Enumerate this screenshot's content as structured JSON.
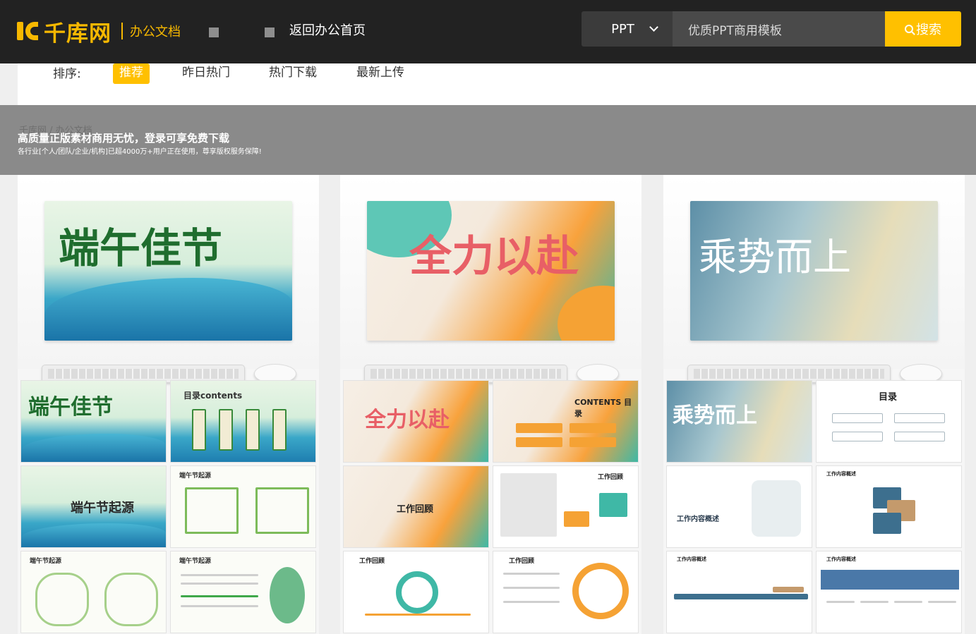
{
  "header": {
    "logo_text": "千库网",
    "logo_sub": "办公文档",
    "back_link": "返回办公首页",
    "search": {
      "type_selected": "PPT",
      "placeholder": "优质PPT商用模板",
      "button_label": "搜索"
    }
  },
  "sort": {
    "label": "排序:",
    "options": [
      "推荐",
      "昨日热门",
      "热门下载",
      "最新上传"
    ]
  },
  "banner": {
    "breadcrumb": "千库网 / 办公文档",
    "title": "高质量正版素材商用无忧，登录可享免费下载",
    "subtitle": "各行业[个人/团队/企业/机构]已超4000万+用户正在使用，尊享版权服务保障!"
  },
  "cards": [
    {
      "cover_title": "端午佳节",
      "slides": [
        "端午佳节",
        "目录contents",
        "端午节起源",
        "端午节起源",
        "端午节起源",
        "端午节起源"
      ]
    },
    {
      "cover_title": "全力以赴",
      "slides": [
        "全力以赴",
        "CONTENTS 目录",
        "工作回顾",
        "工作回顾",
        "工作回顾",
        "工作回顾"
      ]
    },
    {
      "cover_title": "乘势而上",
      "slides": [
        "乘势而上",
        "目录",
        "工作内容概述",
        "工作内容概述",
        "工作内容概述",
        "工作内容概述"
      ]
    }
  ],
  "colors": {
    "topbar": "#222222",
    "accent": "#ffc000",
    "banner": "#8a8a8a"
  }
}
